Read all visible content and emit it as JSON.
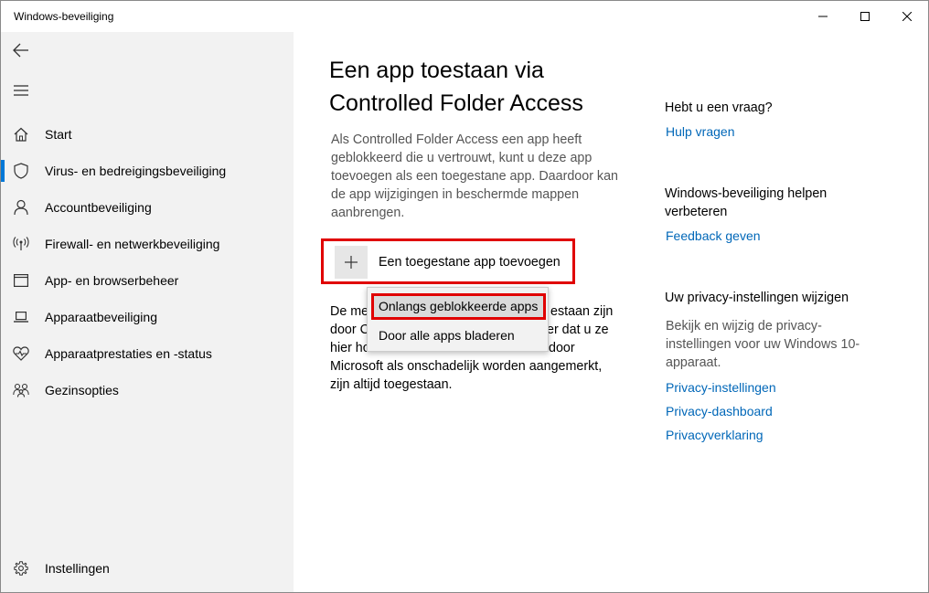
{
  "window": {
    "title": "Windows-beveiliging"
  },
  "sidebar": {
    "items": [
      {
        "label": "Start",
        "icon": "home-icon"
      },
      {
        "label": "Virus- en bedreigingsbeveiliging",
        "icon": "shield-icon",
        "selected": true
      },
      {
        "label": "Accountbeveiliging",
        "icon": "person-icon"
      },
      {
        "label": "Firewall- en netwerkbeveiliging",
        "icon": "wireless-icon"
      },
      {
        "label": "App- en browserbeheer",
        "icon": "app-window-icon"
      },
      {
        "label": "Apparaatbeveiliging",
        "icon": "laptop-icon"
      },
      {
        "label": "Apparaatprestaties en -status",
        "icon": "heart-pulse-icon"
      },
      {
        "label": "Gezinsopties",
        "icon": "family-icon"
      }
    ],
    "settings_label": "Instellingen"
  },
  "main": {
    "title": "Een app toestaan via Controlled Folder Access",
    "description": "Als Controlled Folder Access een app heeft geblokkeerd die u vertrouwt, kunt u deze app toevoegen als een toegestane app. Daardoor kan de app wijzigingen in beschermde mappen aanbrengen.",
    "add_button_label": "Een toegestane app toevoegen",
    "body_lines": [
      "De me",
      "door C",
      "hier ho",
      "Microsoft als onschadelijk worden aangemerkt,",
      "zijn altijd toegestaan."
    ],
    "body_fragments": {
      "line1_tail": "estaan zijn",
      "line2_tail": "er dat u ze",
      "line3_tail": "door"
    }
  },
  "flyout": {
    "items": [
      "Onlangs geblokkeerde apps",
      "Door alle apps bladeren"
    ]
  },
  "right": {
    "question_heading": "Hebt u een vraag?",
    "help_link": "Hulp vragen",
    "improve_heading": "Windows-beveiliging helpen verbeteren",
    "feedback_link": "Feedback geven",
    "privacy_heading": "Uw privacy-instellingen wijzigen",
    "privacy_text": "Bekijk en wijzig de privacy-instellingen voor uw Windows 10-apparaat.",
    "privacy_links": [
      "Privacy-instellingen",
      "Privacy-dashboard",
      "Privacyverklaring"
    ]
  },
  "colors": {
    "accent": "#0078d7",
    "link": "#0067b8",
    "highlight": "#e00000"
  }
}
